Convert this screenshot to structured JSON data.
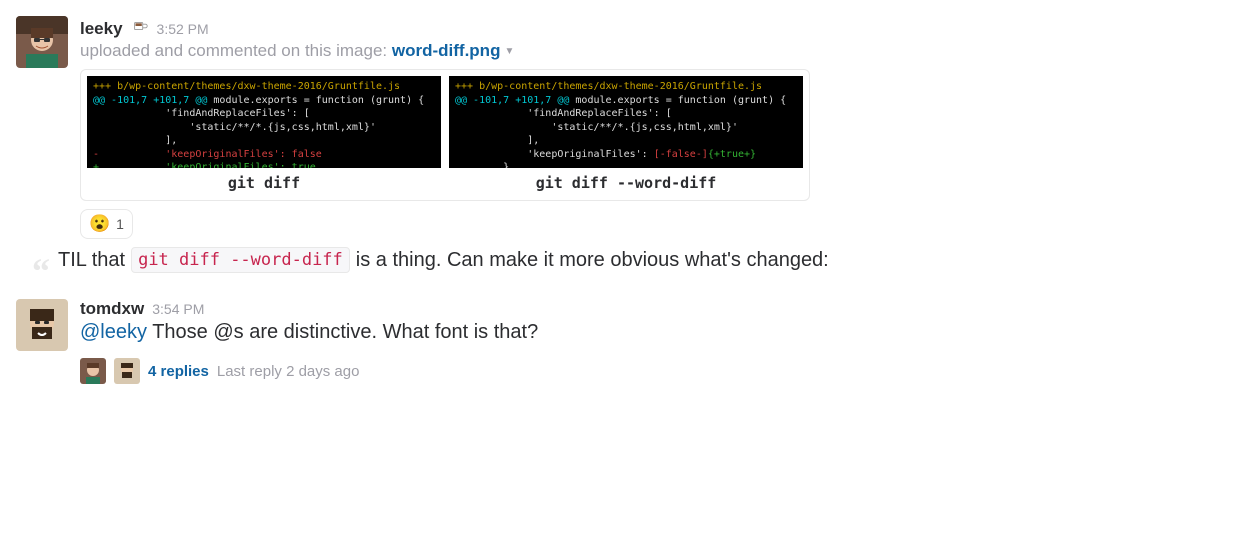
{
  "message1": {
    "username": "leeky",
    "timestamp": "3:52 PM",
    "upload_prefix": "uploaded and commented on this image: ",
    "file_name": "word-diff.png",
    "diff_left": {
      "header": "+++ b/wp-content/themes/dxw-theme-2016/Gruntfile.js",
      "hunk1": "@@ -101,7 +101,7 @@",
      "hunk2": " module.exports = function (grunt) {",
      "line1": "            'findAndReplaceFiles': [",
      "line2": "                'static/**/*.{js,css,html,xml}'",
      "line3": "            ],",
      "del": "-           'keepOriginalFiles': false",
      "add": "+           'keepOriginalFiles': true",
      "label": "git diff"
    },
    "diff_right": {
      "header": "+++ b/wp-content/themes/dxw-theme-2016/Gruntfile.js",
      "hunk1": "@@ -101,7 +101,7 @@",
      "hunk2": " module.exports = function (grunt) {",
      "line1": "            'findAndReplaceFiles': [",
      "line2": "                'static/**/*.{js,css,html,xml}'",
      "line3": "            ],",
      "keep_label": "            'keepOriginalFiles': ",
      "del_word": "[-false-]",
      "add_word": "{+true+}",
      "trail": "        },",
      "label": "git diff --word-diff"
    },
    "reaction": {
      "emoji": "😮",
      "count": "1"
    },
    "comment_pre": "TIL that ",
    "comment_code": "git diff --word-diff",
    "comment_post": " is a thing. Can make it more obvious what's changed:"
  },
  "message2": {
    "username": "tomdxw",
    "timestamp": "3:54 PM",
    "mention": "@leeky",
    "text": " Those @s are distinctive. What font is that?",
    "thread": {
      "replies": "4 replies",
      "last": "Last reply 2 days ago"
    }
  }
}
